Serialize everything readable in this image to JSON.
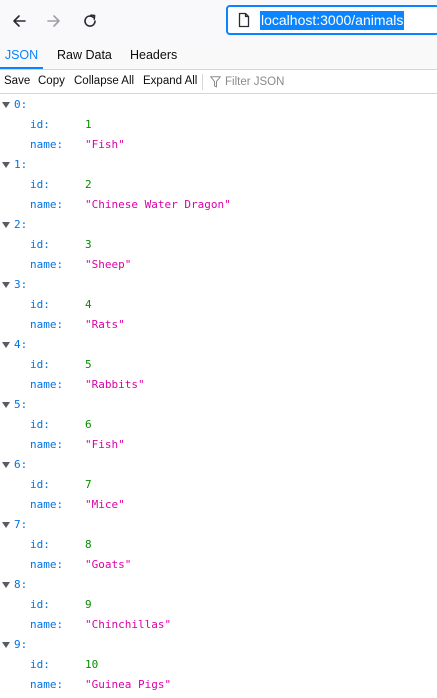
{
  "browser": {
    "url": "localhost:3000/animals"
  },
  "viewer": {
    "tabs": [
      {
        "label": "JSON",
        "active": true
      },
      {
        "label": "Raw Data",
        "active": false
      },
      {
        "label": "Headers",
        "active": false
      }
    ],
    "actions": {
      "save": "Save",
      "copy": "Copy",
      "collapse_all": "Collapse All",
      "expand_all": "Expand All"
    },
    "filter_placeholder": "Filter JSON"
  },
  "tree": [
    {
      "index": "0:",
      "id_key": "id:",
      "id": "1",
      "name_key": "name:",
      "name": "\"Fish\""
    },
    {
      "index": "1:",
      "id_key": "id:",
      "id": "2",
      "name_key": "name:",
      "name": "\"Chinese Water Dragon\""
    },
    {
      "index": "2:",
      "id_key": "id:",
      "id": "3",
      "name_key": "name:",
      "name": "\"Sheep\""
    },
    {
      "index": "3:",
      "id_key": "id:",
      "id": "4",
      "name_key": "name:",
      "name": "\"Rats\""
    },
    {
      "index": "4:",
      "id_key": "id:",
      "id": "5",
      "name_key": "name:",
      "name": "\"Rabbits\""
    },
    {
      "index": "5:",
      "id_key": "id:",
      "id": "6",
      "name_key": "name:",
      "name": "\"Fish\""
    },
    {
      "index": "6:",
      "id_key": "id:",
      "id": "7",
      "name_key": "name:",
      "name": "\"Mice\""
    },
    {
      "index": "7:",
      "id_key": "id:",
      "id": "8",
      "name_key": "name:",
      "name": "\"Goats\""
    },
    {
      "index": "8:",
      "id_key": "id:",
      "id": "9",
      "name_key": "name:",
      "name": "\"Chinchillas\""
    },
    {
      "index": "9:",
      "id_key": "id:",
      "id": "10",
      "name_key": "name:",
      "name": "\"Guinea Pigs\""
    }
  ],
  "colors": {
    "accent": "#0a84ff",
    "json_key": "#0074e8",
    "json_number": "#058b00",
    "json_string": "#dd00a9"
  },
  "icons": [
    "back-arrow-icon",
    "forward-arrow-icon",
    "reload-icon",
    "page-icon",
    "filter-icon",
    "expand-twisty-icon"
  ]
}
